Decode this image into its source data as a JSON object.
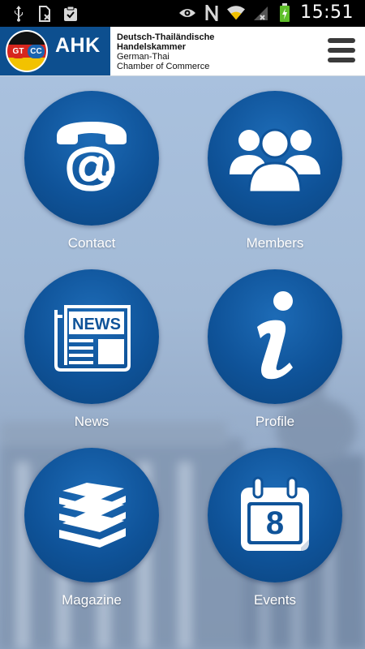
{
  "status_bar": {
    "time": "15:51",
    "icons_left": [
      "usb-icon",
      "sim-blocked-icon",
      "clipboard-check-icon"
    ],
    "icons_right": [
      "eye-icon",
      "nfc-icon",
      "wifi-icon",
      "no-signal-icon",
      "battery-charging-icon"
    ]
  },
  "header": {
    "logo_badge_left": "GT",
    "logo_badge_right": "CC",
    "logo_text": "AHK",
    "line1": "Deutsch-Thailändische",
    "line2": "Handelskammer",
    "line3": "German-Thai",
    "line4": "Chamber of Commerce",
    "brand_color": "#0d4f8f"
  },
  "tiles": [
    {
      "label": "Contact",
      "icon": "phone-at-icon"
    },
    {
      "label": "Members",
      "icon": "people-group-icon"
    },
    {
      "label": "News",
      "icon": "newspaper-icon"
    },
    {
      "label": "Profile",
      "icon": "info-icon"
    },
    {
      "label": "Magazine",
      "icon": "books-stack-icon"
    },
    {
      "label": "Events",
      "icon": "calendar-icon",
      "calendar_day": "8"
    }
  ]
}
